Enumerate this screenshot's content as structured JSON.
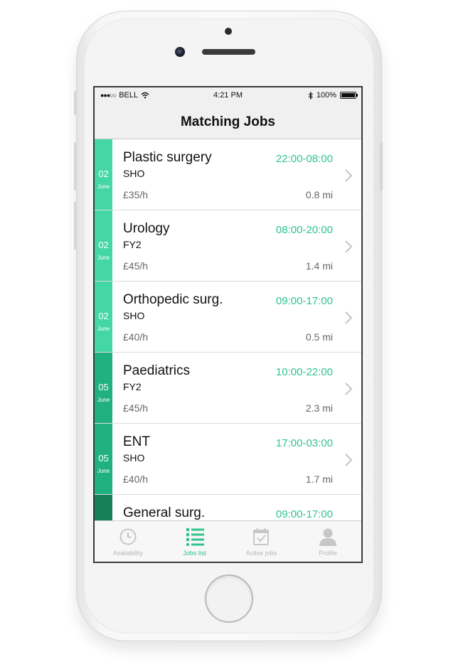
{
  "status_bar": {
    "signal": "●●●○○",
    "carrier": "BELL",
    "time": "4:21 PM",
    "battery": "100%",
    "icons": [
      "wifi-icon",
      "bluetooth-icon",
      "battery-icon"
    ]
  },
  "nav": {
    "title": "Matching Jobs"
  },
  "jobs": [
    {
      "day": "02",
      "month": "June",
      "title": "Plastic surgery",
      "time": "22:00-08:00",
      "grade": "SHO",
      "rate": "£35/h",
      "distance": "0.8 mi",
      "strip_color": "#44d6a4"
    },
    {
      "day": "02",
      "month": "June",
      "title": "Urology",
      "time": "08:00-20:00",
      "grade": "FY2",
      "rate": "£45/h",
      "distance": "1.4 mi",
      "strip_color": "#44d6a4"
    },
    {
      "day": "02",
      "month": "June",
      "title": "Orthopedic surg.",
      "time": "09:00-17:00",
      "grade": "SHO",
      "rate": "£40/h",
      "distance": "0.5 mi",
      "strip_color": "#44d6a4"
    },
    {
      "day": "05",
      "month": "June",
      "title": "Paediatrics",
      "time": "10:00-22:00",
      "grade": "FY2",
      "rate": "£45/h",
      "distance": "2.3 mi",
      "strip_color": "#21b07f"
    },
    {
      "day": "05",
      "month": "June",
      "title": "ENT",
      "time": "17:00-03:00",
      "grade": "SHO",
      "rate": "£40/h",
      "distance": "1.7 mi",
      "strip_color": "#21b07f"
    },
    {
      "day": "",
      "month": "",
      "title": "General surg.",
      "time": "09:00-17:00",
      "grade": "",
      "rate": "",
      "distance": "",
      "strip_color": "#188059"
    }
  ],
  "tabs": [
    {
      "label": "Availability",
      "icon": "clock-icon",
      "active": false
    },
    {
      "label": "Jobs list",
      "icon": "list-icon",
      "active": true
    },
    {
      "label": "Active jobs",
      "icon": "calendar-check-icon",
      "active": false
    },
    {
      "label": "Profile",
      "icon": "person-icon",
      "active": false
    }
  ],
  "colors": {
    "accent": "#2fc48d",
    "inactive_tab": "#b5b5b5"
  }
}
